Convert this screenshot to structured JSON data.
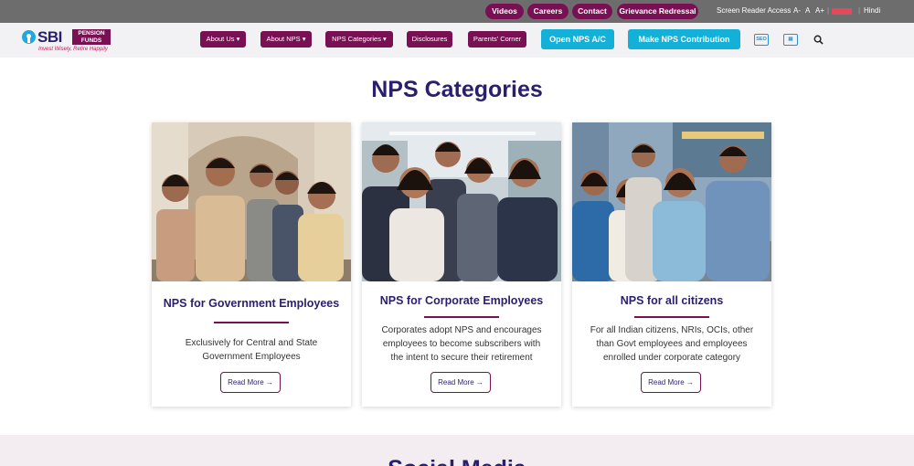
{
  "topbar": {
    "links": [
      "Videos",
      "Careers",
      "Contact",
      "Grievance Redressal"
    ],
    "screen_reader_label": "Screen Reader Access",
    "font_sizes": [
      "A-",
      "A",
      "A+"
    ],
    "lang_option": "Hindi",
    "pill_color": "#7a1054"
  },
  "logo": {
    "brand": "SBI",
    "product_line1": "PENSION",
    "product_line2": "FUNDS",
    "tagline": "Invest Wisely, Retire Happily"
  },
  "nav": {
    "items": [
      "About Us",
      "About NPS",
      "NPS Categories",
      "Disclosures",
      "Parents' Corner"
    ],
    "dropdown_arrow": "⌄",
    "cta_open": "Open NPS A/C",
    "cta_contribute": "Make NPS Contribution",
    "icon1": "SEO",
    "icon2": "▤"
  },
  "section": {
    "heading": "NPS Categories"
  },
  "cards": [
    {
      "title": "NPS for Government Employees",
      "desc_lines": [
        "Exclusively for Central and State",
        "Government Employees"
      ],
      "cta": "Read More",
      "arrow": "→"
    },
    {
      "title": "NPS for Corporate Employees",
      "desc_lines": [
        "Corporates adopt NPS and encourages",
        "employees to become subscribers with",
        "the intent to secure their retirement"
      ],
      "cta": "Read More",
      "arrow": "→"
    },
    {
      "title": "NPS for all citizens",
      "desc_lines": [
        "For all Indian citizens, NRIs, OCIs, other",
        "than Govt employees and employees",
        "enrolled under corporate category"
      ],
      "cta": "Read More",
      "arrow": "→"
    }
  ],
  "band": {
    "title": "Social Media"
  },
  "colors": {
    "primary": "#2a1f6e",
    "accent": "#7a1054",
    "cta": "#13b0d8"
  }
}
